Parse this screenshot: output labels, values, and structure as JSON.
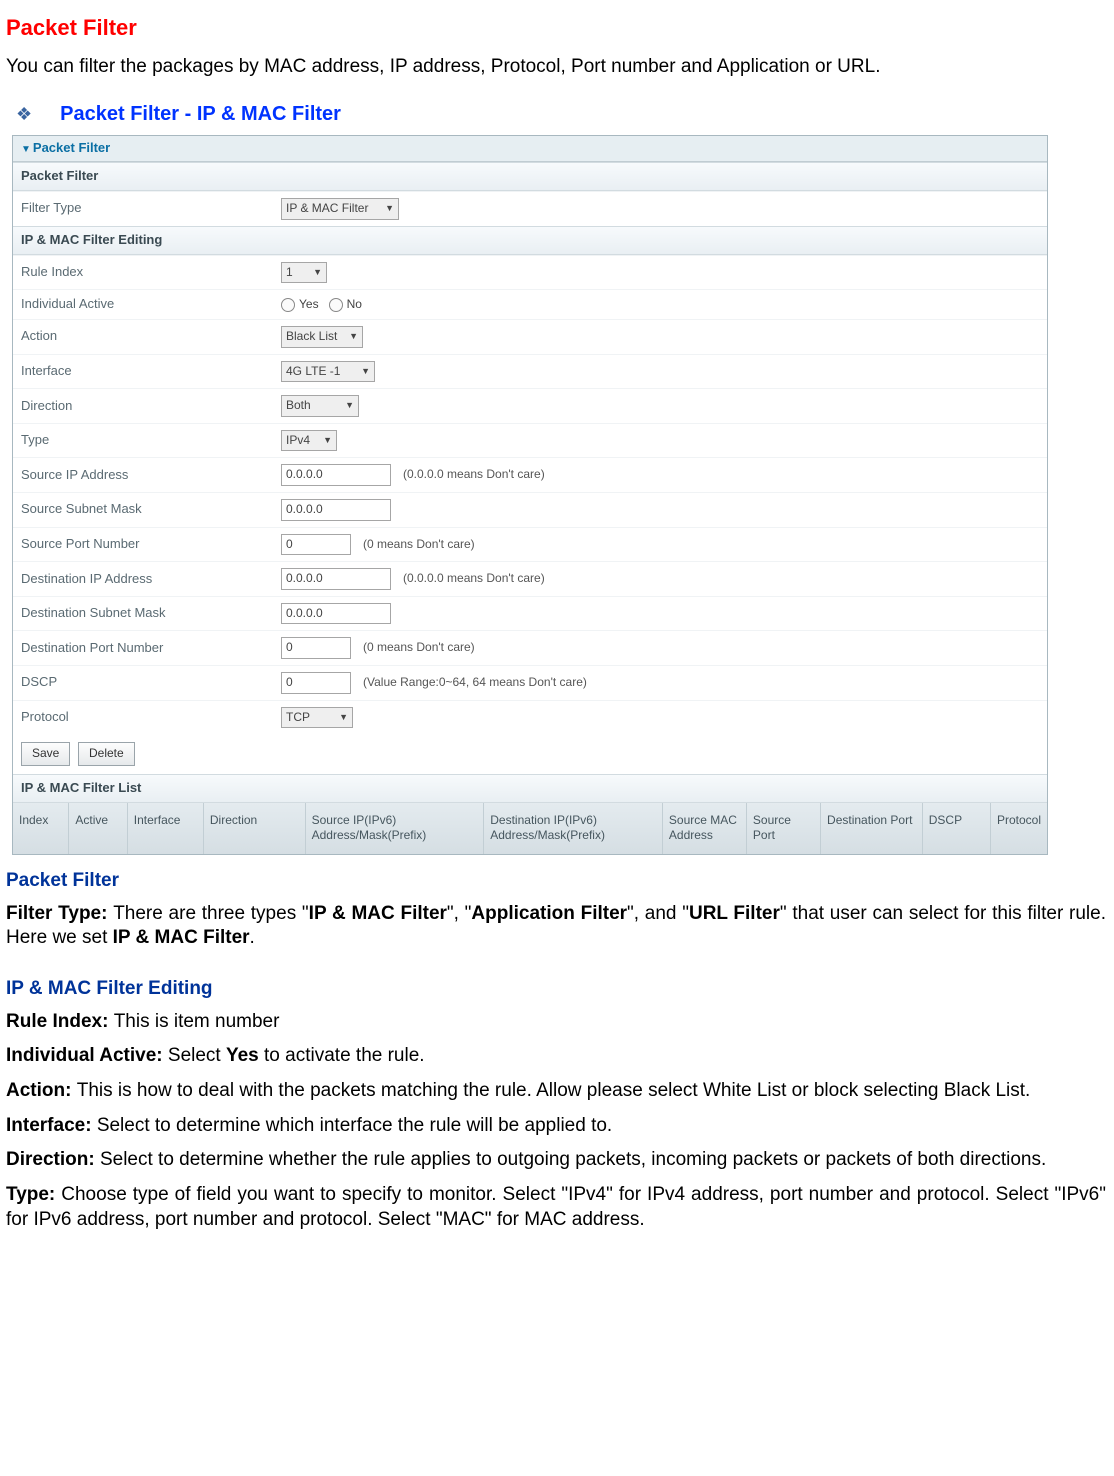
{
  "title": "Packet Filter",
  "intro": "You can filter the packages by MAC address, IP address, Protocol, Port number and Application or URL.",
  "bullet": "Packet Filter - IP & MAC Filter",
  "panel": {
    "header": "Packet Filter",
    "section_filter": "Packet Filter",
    "section_editing": "IP & MAC Filter Editing",
    "section_list": "IP & MAC Filter List",
    "labels": {
      "filter_type": "Filter Type",
      "rule_index": "Rule Index",
      "individual_active": "Individual Active",
      "action": "Action",
      "interface": "Interface",
      "direction": "Direction",
      "type": "Type",
      "src_ip": "Source IP Address",
      "src_mask": "Source Subnet Mask",
      "src_port": "Source Port Number",
      "dst_ip": "Destination IP Address",
      "dst_mask": "Destination Subnet Mask",
      "dst_port": "Destination Port Number",
      "dscp": "DSCP",
      "protocol": "Protocol"
    },
    "values": {
      "filter_type": "IP & MAC Filter",
      "rule_index": "1",
      "yes": "Yes",
      "no": "No",
      "action": "Black List",
      "interface": "4G LTE -1",
      "direction": "Both",
      "type": "IPv4",
      "src_ip": "0.0.0.0",
      "src_mask": "0.0.0.0",
      "src_port": "0",
      "dst_ip": "0.0.0.0",
      "dst_mask": "0.0.0.0",
      "dst_port": "0",
      "dscp": "0",
      "protocol": "TCP"
    },
    "hints": {
      "src_ip": "(0.0.0.0 means Don't care)",
      "src_port": "(0 means Don't care)",
      "dst_ip": "(0.0.0.0 means Don't care)",
      "dst_port": "(0 means Don't care)",
      "dscp": "(Value Range:0~64, 64 means Don't care)"
    },
    "buttons": {
      "save": "Save",
      "delete": "Delete"
    },
    "cols": {
      "index": "Index",
      "active": "Active",
      "interface": "Interface",
      "direction": "Direction",
      "src": "Source IP(IPv6) Address/Mask(Prefix)",
      "dst": "Destination IP(IPv6) Address/Mask(Prefix)",
      "mac": "Source MAC Address",
      "sport": "Source Port",
      "dport": "Destination Port",
      "dscp": "DSCP",
      "protocol": "Protocol"
    }
  },
  "doc": {
    "h_packet_filter": "Packet Filter",
    "filter_type_label": "Filter Type: ",
    "filter_type_1": "There are three types \"",
    "filter_type_b1": "IP & MAC Filter",
    "filter_type_2": "\", \"",
    "filter_type_b2": "Application Filter",
    "filter_type_3": "\", and \"",
    "filter_type_b3": "URL Filter",
    "filter_type_4": "\" that user can select for this filter rule. Here we set ",
    "filter_type_b4": "IP & MAC Filter",
    "filter_type_5": ".",
    "h_editing": "IP & MAC Filter Editing",
    "rule_index_label": "Rule Index: ",
    "rule_index_text": "This is item number",
    "individual_label": "Individual Active: ",
    "individual_1": "Select ",
    "individual_b": "Yes",
    "individual_2": " to activate the rule.",
    "action_label": "Action: ",
    "action_text": "This is how to deal with the packets matching the rule. Allow please select White List or block selecting Black List.",
    "interface_label": "Interface: ",
    "interface_text": "Select to determine which interface the rule will be applied to.",
    "direction_label": "Direction: ",
    "direction_text": "Select to determine whether the rule applies to outgoing packets, incoming packets or packets of both directions.",
    "type_label": "Type: ",
    "type_text": "Choose type of field you want to specify to monitor. Select \"IPv4\" for IPv4 address, port number and protocol. Select \"IPv6\" for IPv6 address, port number and protocol. Select \"MAC\" for MAC address."
  }
}
